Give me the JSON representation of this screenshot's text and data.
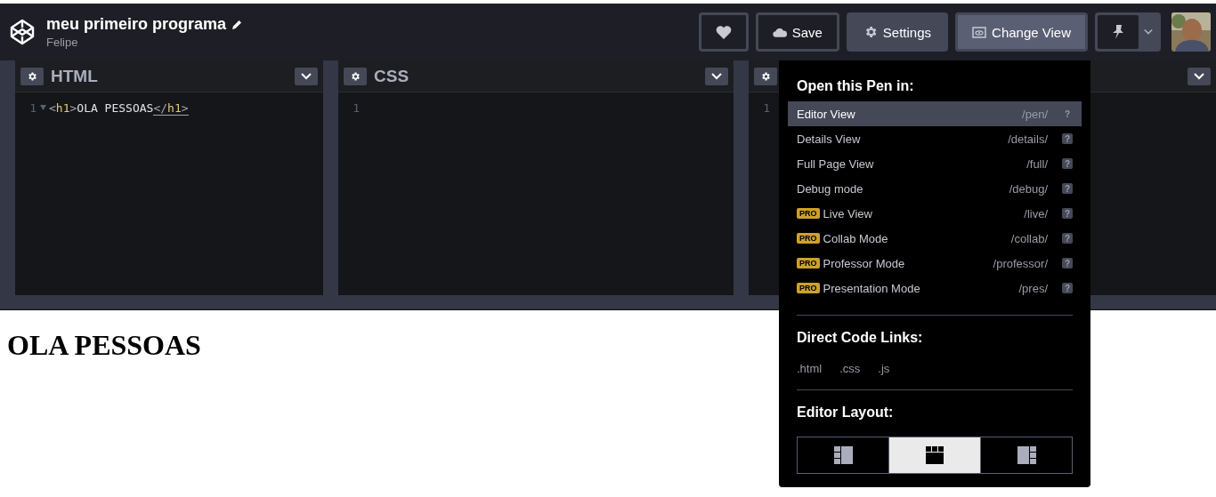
{
  "header": {
    "title": "meu primeiro programa",
    "author": "Felipe",
    "buttons": [
      {
        "kind": "heart"
      },
      {
        "kind": "save",
        "label": "Save"
      },
      {
        "kind": "settings",
        "label": "Settings"
      },
      {
        "kind": "view",
        "label": "Change View"
      }
    ]
  },
  "editors": [
    {
      "title": "HTML",
      "lines": [
        {
          "number": "1",
          "foldable": true,
          "tokens": [
            {
              "kind": "punct",
              "text": "<",
              "underlined": false
            },
            {
              "kind": "tag",
              "text": "h1",
              "underlined": false
            },
            {
              "kind": "punct",
              "text": ">",
              "underlined": false
            },
            {
              "kind": "text",
              "text": "OLA PESSOAS",
              "underlined": false
            },
            {
              "kind": "punct",
              "text": "</",
              "underlined": true
            },
            {
              "kind": "tag",
              "text": "h1",
              "underlined": true
            },
            {
              "kind": "punct",
              "text": ">",
              "underlined": true
            }
          ]
        }
      ]
    },
    {
      "title": "CSS",
      "lines": [
        {
          "number": "1",
          "foldable": false
        }
      ]
    },
    {
      "lines": [
        {
          "number": "1",
          "foldable": false
        }
      ]
    }
  ],
  "preview": {
    "heading": "OLA PESSOAS"
  },
  "dropdown": {
    "open_title": "Open this Pen in:",
    "items": [
      {
        "label": "Editor View",
        "path": "/pen/",
        "selected": true
      },
      {
        "label": "Details View",
        "path": "/details/",
        "selected": false
      },
      {
        "label": "Full Page View",
        "path": "/full/",
        "selected": false
      },
      {
        "label": "Debug mode",
        "path": "/debug/",
        "selected": false
      },
      {
        "label": "Live View",
        "path": "/live/",
        "badge": "PRO",
        "selected": false
      },
      {
        "label": "Collab Mode",
        "path": "/collab/",
        "badge": "PRO",
        "selected": false
      },
      {
        "label": "Professor Mode",
        "path": "/professor/",
        "badge": "PRO",
        "selected": false
      },
      {
        "label": "Presentation Mode",
        "path": "/pres/",
        "badge": "PRO",
        "selected": false
      }
    ],
    "help_mark": "?",
    "links_title": "Direct Code Links:",
    "links": [
      ".html",
      ".css",
      ".js"
    ],
    "layout_title": "Editor Layout:",
    "layouts": [
      {
        "kind": "left",
        "selected": false
      },
      {
        "kind": "top",
        "selected": true
      },
      {
        "kind": "right",
        "selected": false
      }
    ]
  }
}
